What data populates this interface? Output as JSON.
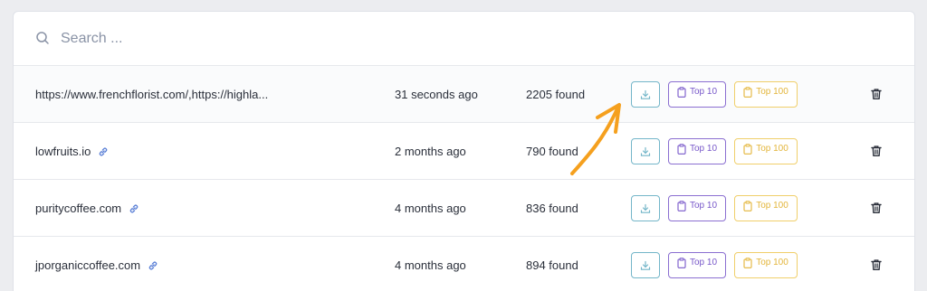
{
  "search": {
    "placeholder": "Search ...",
    "value": ""
  },
  "colors": {
    "download": "#74b6c9",
    "top10": "#8b6fd1",
    "top100": "#f0cf6a",
    "arrow": "#f5a01e"
  },
  "rows": [
    {
      "url": "https://www.frenchflorist.com/,https://highla...",
      "has_link_icon": false,
      "time": "31 seconds ago",
      "found": "2205 found",
      "top10_label": "Top 10",
      "top100_label": "Top 100"
    },
    {
      "url": "lowfruits.io",
      "has_link_icon": true,
      "time": "2 months ago",
      "found": "790 found",
      "top10_label": "Top 10",
      "top100_label": "Top 100"
    },
    {
      "url": "puritycoffee.com",
      "has_link_icon": true,
      "time": "4 months ago",
      "found": "836 found",
      "top10_label": "Top 10",
      "top100_label": "Top 100"
    },
    {
      "url": "jporganiccoffee.com",
      "has_link_icon": true,
      "time": "4 months ago",
      "found": "894 found",
      "top10_label": "Top 10",
      "top100_label": "Top 100"
    }
  ],
  "icons": {
    "search": "search-icon",
    "link": "link-icon",
    "download": "download-icon",
    "clipboard": "clipboard-icon",
    "trash": "trash-icon",
    "annotation": "arrow-annotation"
  }
}
